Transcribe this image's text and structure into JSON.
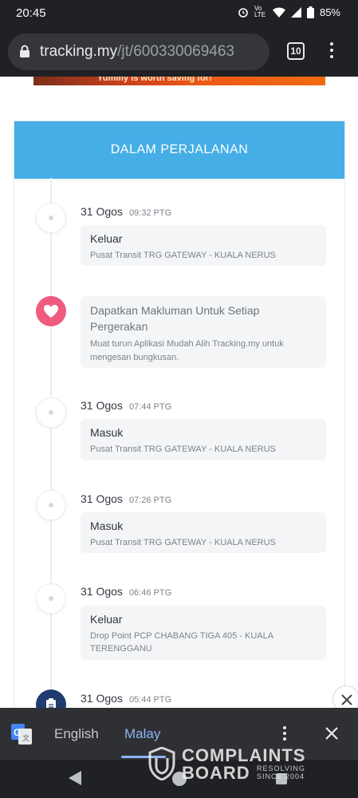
{
  "status_bar": {
    "time": "20:45",
    "alarm_icon": "alarm-icon",
    "volte_label": "Vo LTE",
    "wifi_icon": "wifi-icon",
    "signal_icon": "signal-icon",
    "battery_icon": "battery-icon",
    "battery": "85%"
  },
  "browser": {
    "url_host": "tracking.my",
    "url_path": "/jt/600330069463",
    "tab_count": "10",
    "lock_icon": "lock-icon",
    "menu_icon": "more-vert-icon"
  },
  "ad_banner": {
    "text": "Yummy is worth saving for!",
    "colors": [
      "#c8401a",
      "#f06b12"
    ]
  },
  "tracking": {
    "header_title": "DALAM PERJALANAN",
    "header_color": "#45aee7",
    "events": [
      {
        "date": "31 Ogos",
        "time": "09:32 PTG",
        "status": "Keluar",
        "location": "Pusat Transit TRG GATEWAY - KUALA NERUS"
      },
      {
        "date": "31 Ogos",
        "time": "07:44 PTG",
        "status": "Masuk",
        "location": "Pusat Transit TRG GATEWAY - KUALA NERUS"
      },
      {
        "date": "31 Ogos",
        "time": "07:26 PTG",
        "status": "Masuk",
        "location": "Pusat Transit TRG GATEWAY - KUALA NERUS"
      },
      {
        "date": "31 Ogos",
        "time": "06:46 PTG",
        "status": "Keluar",
        "location": "Drop Point PCP CHABANG TIGA 405 - KUALA TERENGGANU"
      },
      {
        "date": "31 Ogos",
        "time": "05:44 PTG"
      }
    ],
    "promo": {
      "title": "Dapatkan Makluman Untuk Setiap Pergerakan",
      "description": "Muat turun Aplikasi Mudah Alih Tracking.my untuk mengesan bungkusan.",
      "icon": "heart-icon",
      "color": "#ef5b7f"
    }
  },
  "translate_bar": {
    "icon": "google-translate-icon",
    "languages": [
      "English",
      "Malay"
    ],
    "selected": "Malay",
    "menu_icon": "more-vert-icon",
    "close_icon": "close-icon"
  },
  "nav_bar": {
    "back_icon": "back-icon",
    "home_icon": "home-icon",
    "recents_icon": "recents-icon"
  },
  "watermark": {
    "line1": "COMPLAINTS",
    "line2": "BOARD",
    "tagline1": "RESOLVING",
    "tagline2": "SINCE 2004"
  }
}
